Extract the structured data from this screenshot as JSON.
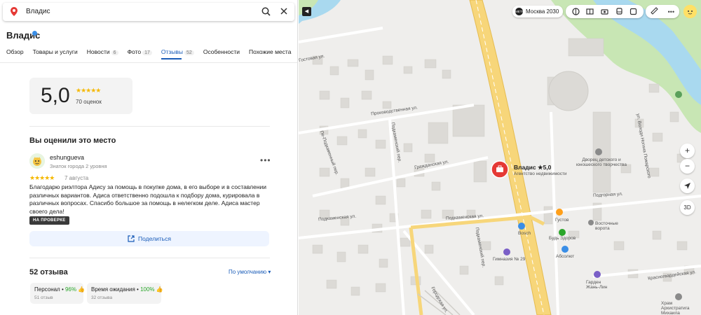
{
  "search": {
    "value": "Владис"
  },
  "org": {
    "name": "Владис",
    "tabs": [
      {
        "label": "Обзор",
        "count": ""
      },
      {
        "label": "Товары и услуги",
        "count": ""
      },
      {
        "label": "Новости",
        "count": "6"
      },
      {
        "label": "Фото",
        "count": "17"
      },
      {
        "label": "Отзывы",
        "count": "52"
      },
      {
        "label": "Особенности",
        "count": ""
      },
      {
        "label": "Похожие места",
        "count": ""
      }
    ],
    "active_tab": "Отзывы"
  },
  "rating": {
    "value": "5,0",
    "stars": 5,
    "count_label": "70 оценок"
  },
  "my_review": {
    "heading": "Вы оценили это место",
    "user": "eshungueva",
    "user_status": "Знаток города 2 уровня",
    "stars": 5,
    "date": "7 августа",
    "text": "Благодарю риэлтора Адису за помощь в покупке дома, в его выборе и в составлении различных вариантов. Адиса ответственно подошла к подбору дома, курировала в различных вопросах. Спасибо большое за помощь в нелегком деле. Адиса мастер своего дела!",
    "badge": "НА ПРОВЕРКЕ",
    "share_label": "Поделиться"
  },
  "reviews": {
    "heading": "52 отзыва",
    "sort_label": "По умолчанию ▾",
    "chips": [
      {
        "name": "Персонал",
        "percent": "96%",
        "sub": "51 отзыв"
      },
      {
        "name": "Время ожидания",
        "percent": "100%",
        "sub": "32 отзыва"
      }
    ]
  },
  "map": {
    "metro_label": "Москва 2030",
    "place_title": "Владис ★5,0",
    "place_subtitle": "Агентство недвижимости",
    "streets": {
      "s1": "Производственная ул.",
      "s2": "Гражданская ул.",
      "s3": "Подкаменская ул.",
      "s4": "Подкаменская ул.",
      "s5": "Подгорная ул.",
      "s6": "Подкаменский пер.",
      "s7": "Пе-Подкаменный пер.",
      "s8": "Красногвардейская ул.",
      "s9": "Городская ул.",
      "s10": "Гостовая ул.",
      "s11": "ул. Володи Ногина Пожарского",
      "s12": "Подкаменский пер."
    },
    "pois": {
      "dvorets": "Дворец детского и юношеского творчества",
      "gustov": "Густов",
      "vostochnye": "Восточные ворота",
      "bud_zdorov": "Будь Здоров",
      "absolut": "Абсолют",
      "bosch": "Bosch",
      "gimnaziya": "Гимназия № 29",
      "garden": "Гарден Жань-Лин",
      "hram": "Храм Архистратига Михаила"
    },
    "ctrl": {
      "zoom_in": "+",
      "zoom_out": "−",
      "mode3d": "3D"
    },
    "colors": {
      "highway": "#f7d67a",
      "road": "#ffffff",
      "river": "#a9d9ef",
      "green": "#c8e6b4",
      "building": "#dcdad6",
      "pin": "#e53935"
    }
  }
}
